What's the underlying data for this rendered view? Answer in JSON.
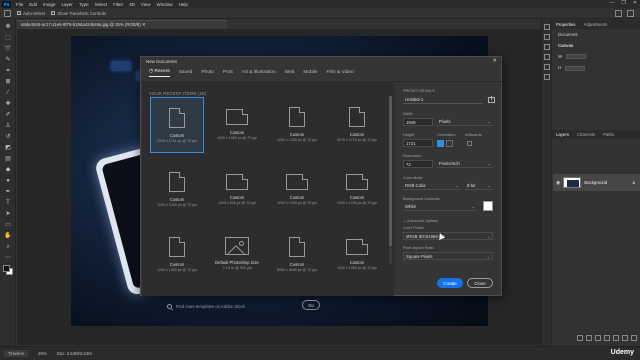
{
  "menubar": {
    "logo": "Ps",
    "items": [
      "File",
      "Edit",
      "Image",
      "Layer",
      "Type",
      "Select",
      "Filter",
      "3D",
      "View",
      "Window",
      "Help"
    ],
    "window_controls": [
      "—",
      "❐",
      "✕"
    ]
  },
  "options_bar": {
    "auto_select_label": "Auto-Select",
    "show_transform_label": "Show Transform Controls"
  },
  "document": {
    "tab_title": "a8de4549-ac17-11e6-9f76-b19da424b45a.jpg @ 25% (RGB/8) ✕"
  },
  "status_bar": {
    "tab_label": "Timeline",
    "zoom": "25%",
    "info": "Doc: 2.64M/2.64M",
    "watermark": "Udemy"
  },
  "right_panel": {
    "tabs": [
      "Properties",
      "Adjustments"
    ],
    "doc_label": "Document",
    "canvas_heading": "Canvas",
    "w_label": "W",
    "h_label": "H",
    "layers_tabs": [
      "Layers",
      "Channels",
      "Paths"
    ],
    "layer_name": "Background"
  },
  "dialog": {
    "title": "New Document",
    "close_glyph": "✕",
    "tabs": [
      {
        "label": "Recent",
        "active": true
      },
      {
        "label": "Saved",
        "active": false
      },
      {
        "label": "Photo",
        "active": false
      },
      {
        "label": "Print",
        "active": false
      },
      {
        "label": "Art & Illustration",
        "active": false
      },
      {
        "label": "Web",
        "active": false
      },
      {
        "label": "Mobile",
        "active": false
      },
      {
        "label": "Film & Video",
        "active": false
      }
    ],
    "recent_title": "YOUR RECENT ITEMS (15)",
    "presets": [
      {
        "name": "Custom",
        "dim": "1949 x 1721 px @ 72 ppi",
        "kind": "doc",
        "selected": true
      },
      {
        "name": "Custom",
        "dim": "1920 x 1080 px @ 72 ppi",
        "kind": "land",
        "selected": false
      },
      {
        "name": "Custom",
        "dim": "1600 x 1200 px @ 72 ppi",
        "kind": "doc",
        "selected": false
      },
      {
        "name": "Custom",
        "dim": "3276 x 2776 px @ 72 ppi",
        "kind": "doc",
        "selected": false
      },
      {
        "name": "Custom",
        "dim": "1200 x 1200 px @ 72 ppi",
        "kind": "doc",
        "selected": false
      },
      {
        "name": "Custom",
        "dim": "1200 x 628 px @ 72 ppi",
        "kind": "land",
        "selected": false
      },
      {
        "name": "Custom",
        "dim": "1200 x 1200 px @ 72 ppi",
        "kind": "land",
        "selected": false
      },
      {
        "name": "Custom",
        "dim": "1200 x 1200 px @ 72 ppi",
        "kind": "land",
        "selected": false
      },
      {
        "name": "Custom",
        "dim": "1200 x 1200 px @ 72 ppi",
        "kind": "doc",
        "selected": false
      },
      {
        "name": "Default Photoshop Size",
        "dim": "7 x 5 in @ 300 ppi",
        "kind": "image",
        "selected": false
      },
      {
        "name": "Custom",
        "dim": "6000 x 4000 px @ 72 ppi",
        "kind": "doc",
        "selected": false
      },
      {
        "name": "Custom",
        "dim": "1920 x 1080 px @ 72 ppi",
        "kind": "land",
        "selected": false
      }
    ],
    "search_placeholder": "Find more templates on Adobe Stock",
    "go_label": "Go",
    "details": {
      "heading": "PRESET DETAILS",
      "name": "Untitled-1",
      "width_label": "Width",
      "width_value": "1949",
      "width_unit": "Pixels",
      "height_label": "Height",
      "height_value": "1721",
      "orientation_label": "Orientation",
      "artboards_label": "Artboards",
      "resolution_label": "Resolution",
      "resolution_value": "72",
      "resolution_unit": "Pixels/Inch",
      "color_mode_label": "Color Mode",
      "color_mode_value": "RGB Color",
      "bit_depth_value": "8 bit",
      "bg_contents_label": "Background Contents",
      "bg_contents_value": "White",
      "advanced_label": "Advanced Options",
      "color_profile_label": "Color Profile",
      "color_profile_value": "sRGB IEC61966-2.1",
      "pixel_aspect_label": "Pixel Aspect Ratio",
      "pixel_aspect_value": "Square Pixels"
    },
    "create_label": "Create",
    "close_label": "Close"
  },
  "colors": {
    "accent": "#1473e6",
    "selection": "#2f8ee6",
    "dialog_bg": "#353535"
  }
}
